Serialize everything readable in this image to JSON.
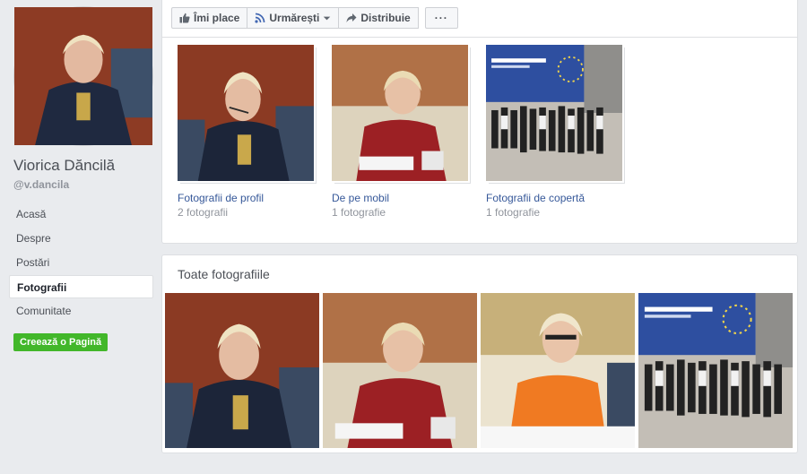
{
  "profile": {
    "name": "Viorica Dăncilă",
    "handle": "@v.dancila"
  },
  "nav": {
    "items": [
      {
        "label": "Acasă",
        "active": false
      },
      {
        "label": "Despre",
        "active": false
      },
      {
        "label": "Postări",
        "active": false
      },
      {
        "label": "Fotografii",
        "active": true
      },
      {
        "label": "Comunitate",
        "active": false
      }
    ],
    "create_page_label": "Creează o Pagină"
  },
  "actions": {
    "like_label": "Îmi place",
    "follow_label": "Urmărești",
    "share_label": "Distribuie",
    "more_label": "···"
  },
  "albums": [
    {
      "title": "Fotografii de profil",
      "count": "2 fotografii"
    },
    {
      "title": "De pe mobil",
      "count": "1 fotografie"
    },
    {
      "title": "Fotografii de copertă",
      "count": "1 fotografie"
    }
  ],
  "all_photos": {
    "title": "Toate fotografiile"
  },
  "colors": {
    "link": "#365899",
    "create_button": "#42b72a",
    "background": "#e9ebee"
  }
}
